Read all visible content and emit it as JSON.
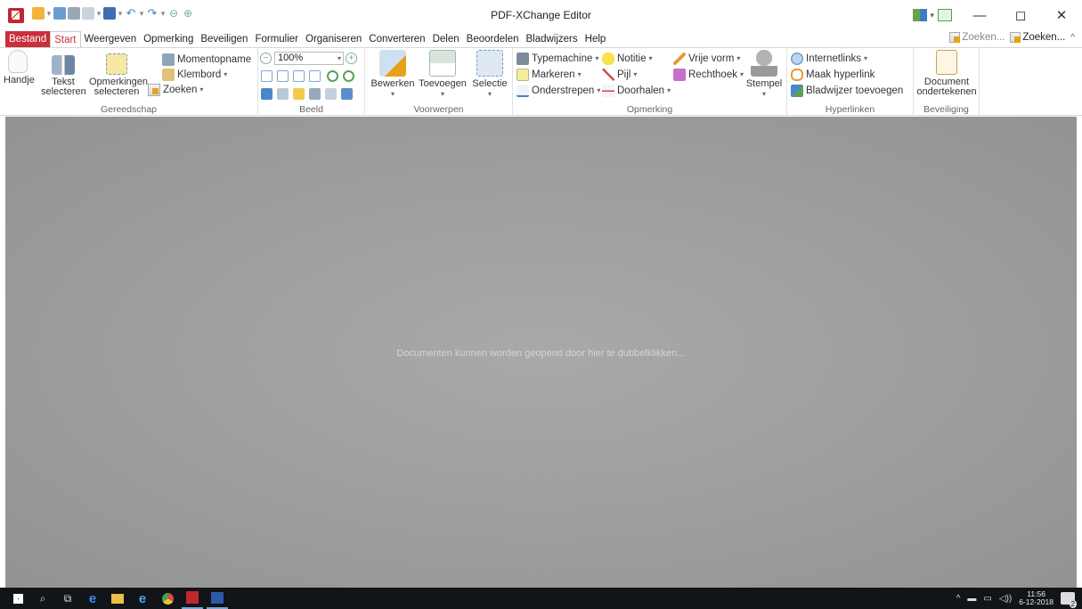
{
  "window": {
    "title": "PDF-XChange Editor",
    "minimize": "—",
    "restore": "◻",
    "close": "✕"
  },
  "menu": {
    "file": "Bestand",
    "tabs": [
      "Start",
      "Weergeven",
      "Opmerking",
      "Beveiligen",
      "Formulier",
      "Organiseren",
      "Converteren",
      "Delen",
      "Beoordelen",
      "Bladwijzers",
      "Help"
    ],
    "search_hint": "Zoeken...",
    "search_main": "Zoeken...",
    "collapse": "^"
  },
  "ribbon": {
    "tools": {
      "hand": "Handje",
      "select_text_1": "Tekst",
      "select_text_2": "selecteren",
      "select_comments_1": "Opmerkingen",
      "select_comments_2": "selecteren",
      "snapshot": "Momentopname",
      "clipboard": "Klembord",
      "find": "Zoeken",
      "group": "Gereedschap"
    },
    "view": {
      "zoom": "100%",
      "group": "Beeld"
    },
    "objects": {
      "edit": "Bewerken",
      "add": "Toevoegen",
      "selection": "Selectie",
      "group": "Voorwerpen"
    },
    "comment": {
      "typewriter": "Typemachine",
      "note": "Notitie",
      "freehand": "Vrije vorm",
      "highlight": "Markeren",
      "arrow": "Pijl",
      "rectangle": "Rechthoek",
      "underline": "Onderstrepen",
      "strikeout": "Doorhalen",
      "stamp": "Stempel",
      "group": "Opmerking"
    },
    "links": {
      "internet_links": "Internetlinks",
      "make_hyperlink": "Maak hyperlink",
      "add_bookmark": "Bladwijzer toevoegen",
      "group": "Hyperlinken"
    },
    "security": {
      "sign_1": "Document",
      "sign_2": "ondertekenen",
      "group": "Beveiliging"
    }
  },
  "document": {
    "hint": "Documenten kunnen worden geopend door hier te dubbelklikken..."
  },
  "taskbar": {
    "time": "11:56",
    "date": "6-12-2018",
    "notifications": "2"
  },
  "colors": {
    "accent": "#c8303a",
    "doc_bg": "#9f9f9f",
    "taskbar": "#111419"
  }
}
